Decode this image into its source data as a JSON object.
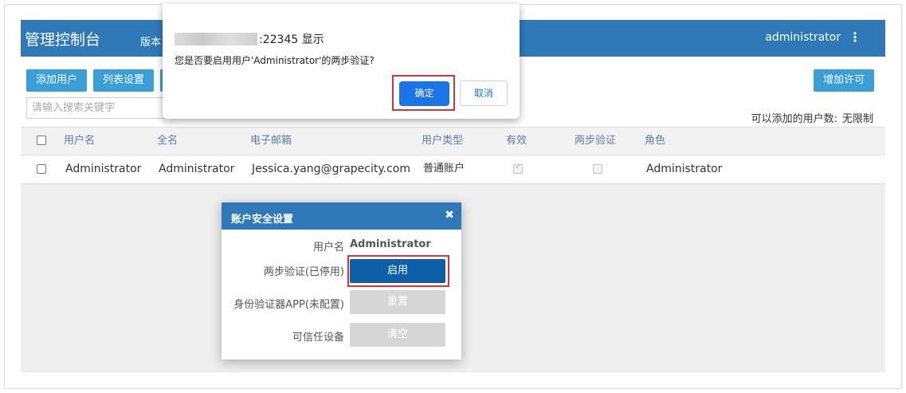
{
  "header": {
    "title": "管理控制台",
    "version": "版本",
    "user": "administrator",
    "more_icon": "⋮"
  },
  "toolbar": {
    "add_user": "添加用户",
    "list_settings": "列表设置",
    "add_license": "增加许可",
    "search_placeholder": "请输入搜索关键字",
    "limit_label": "可以添加的用户数:",
    "limit_value": "无限制"
  },
  "table": {
    "columns": [
      "用户名",
      "全名",
      "电子邮箱",
      "用户类型",
      "有效",
      "两步验证",
      "角色"
    ],
    "rows": [
      {
        "username": "Administrator",
        "fullname": "Administrator",
        "email": "Jessica.yang@grapecity.com",
        "type": "普通账户",
        "valid": true,
        "two_step": false,
        "role": "Administrator"
      }
    ]
  },
  "alert": {
    "origin": ":22345 显示",
    "message": "您是否要启用用户'Administrator'的两步验证?",
    "ok": "确定",
    "cancel": "取消"
  },
  "modal": {
    "title": "账户安全设置",
    "close_icon": "✖",
    "username_label": "用户名",
    "username_value": "Administrator",
    "two_step_label": "两步验证(已停用)",
    "two_step_button": "启用",
    "authenticator_label": "身份验证器APP(未配置)",
    "authenticator_button": "重置",
    "trusted_label": "可信任设备",
    "trusted_button": "清空"
  },
  "colors": {
    "header": "#2f79b9",
    "button": "#3a9ed8",
    "highlight": "#d9343b",
    "primary": "#0d5fa8"
  }
}
